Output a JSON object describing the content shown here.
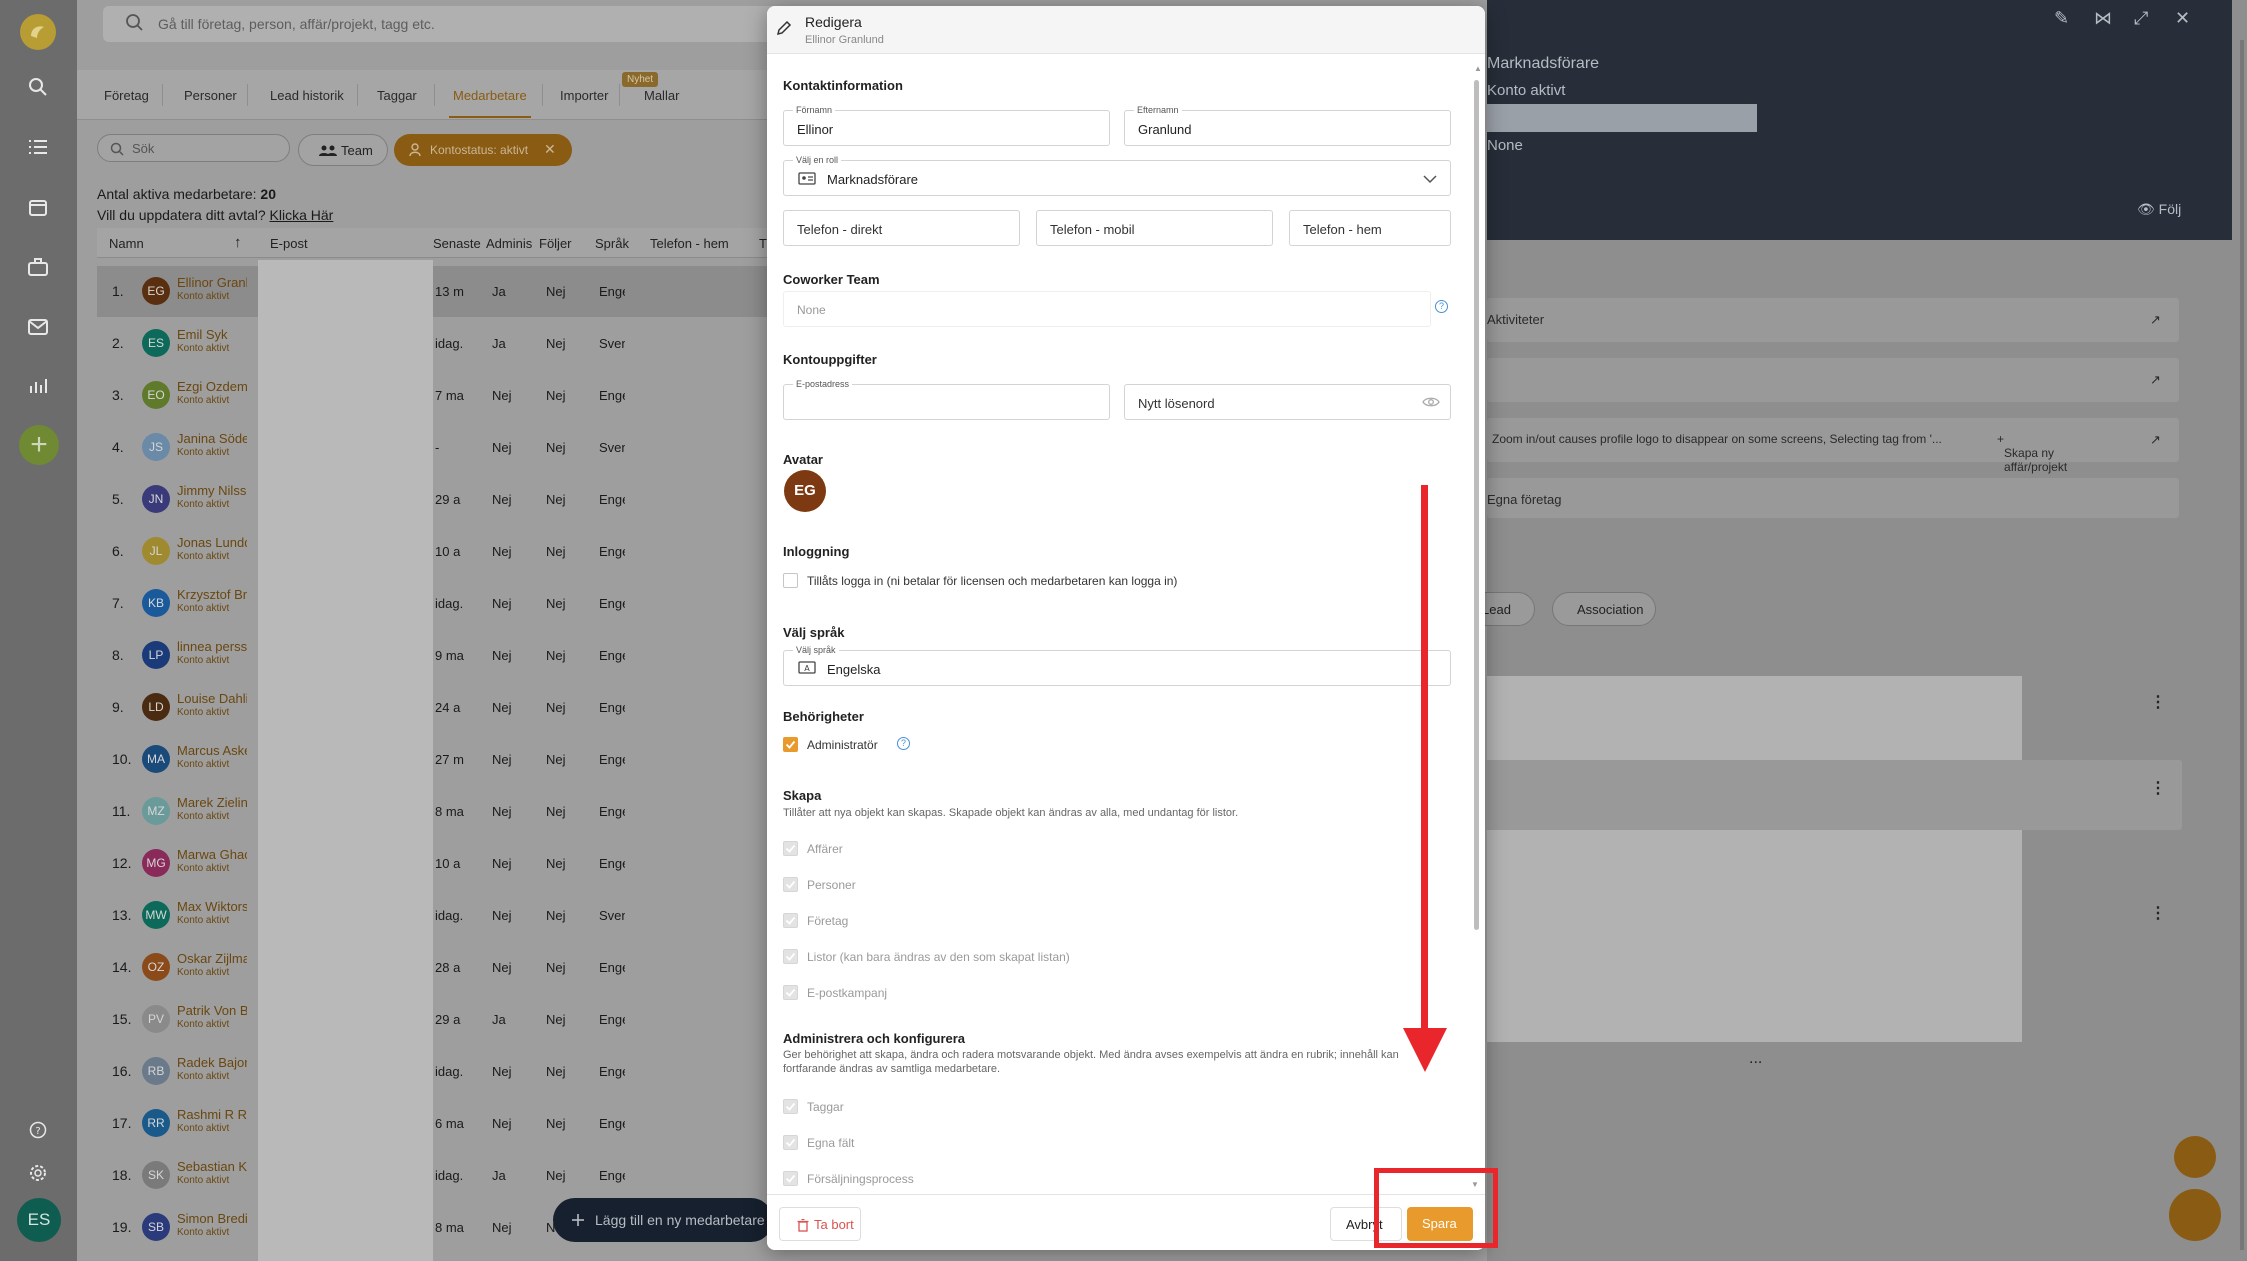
{
  "search": {
    "placeholder": "Gå till företag, person, affär/projekt, tagg etc."
  },
  "tabs": [
    {
      "label": "Företag"
    },
    {
      "label": "Personer"
    },
    {
      "label": "Lead historik"
    },
    {
      "label": "Taggar"
    },
    {
      "label": "Medarbetare"
    },
    {
      "label": "Importer"
    },
    {
      "label": "Mallar"
    }
  ],
  "nyhet_badge": "Nyhet",
  "filters": {
    "search_placeholder": "Sök",
    "team_label": "Team",
    "status_chip": "Kontostatus: aktivt"
  },
  "summary": {
    "count_label": "Antal aktiva medarbetare:",
    "count_value": "20",
    "update_text": "Vill du uppdatera ditt avtal?",
    "update_link": "Klicka Här"
  },
  "table": {
    "headers": [
      "Namn",
      "E-post",
      "Senaste",
      "Adminis",
      "Följer",
      "Språk",
      "Telefon - hem",
      "T"
    ],
    "status_label": "Konto aktivt",
    "rows": [
      {
        "num": "1.",
        "initials": "EG",
        "color": "#5a2f10",
        "name": "Ellinor Granlund",
        "senaste": "13 m",
        "admin": "Ja",
        "foljer": "Nej",
        "sprak": "Engelska"
      },
      {
        "num": "2.",
        "initials": "ES",
        "color": "#0d6a5a",
        "name": "Emil Syk",
        "senaste": "idag.",
        "admin": "Ja",
        "foljer": "Nej",
        "sprak": "Svenska"
      },
      {
        "num": "3.",
        "initials": "EO",
        "color": "#5f7a2a",
        "name": "Ezgi Ozdemir",
        "senaste": "7 ma",
        "admin": "Nej",
        "foljer": "Nej",
        "sprak": "Engelska"
      },
      {
        "num": "4.",
        "initials": "JS",
        "color": "#6a8aa8",
        "name": "Janina Söderberg",
        "senaste": "-",
        "admin": "Nej",
        "foljer": "Nej",
        "sprak": "Svenska"
      },
      {
        "num": "5.",
        "initials": "JN",
        "color": "#3a3a7a",
        "name": "Jimmy Nilsson",
        "senaste": "29 a",
        "admin": "Nej",
        "foljer": "Nej",
        "sprak": "Engelska"
      },
      {
        "num": "6.",
        "initials": "JL",
        "color": "#a08a30",
        "name": "Jonas Lundqvist",
        "senaste": "10 a",
        "admin": "Nej",
        "foljer": "Nej",
        "sprak": "Engelska"
      },
      {
        "num": "7.",
        "initials": "KB",
        "color": "#1a5a9a",
        "name": "Krzysztof Brzozowski",
        "senaste": "idag.",
        "admin": "Nej",
        "foljer": "Nej",
        "sprak": "Engelska"
      },
      {
        "num": "8.",
        "initials": "LP",
        "color": "#1a3a7a",
        "name": "linnea persson",
        "senaste": "9 ma",
        "admin": "Nej",
        "foljer": "Nej",
        "sprak": "Engelska"
      },
      {
        "num": "9.",
        "initials": "LD",
        "color": "#4a2a10",
        "name": "Louise Dahlin",
        "senaste": "24 a",
        "admin": "Nej",
        "foljer": "Nej",
        "sprak": "Engelska"
      },
      {
        "num": "10.",
        "initials": "MA",
        "color": "#1a4a7a",
        "name": "Marcus Askeröd",
        "senaste": "27 m",
        "admin": "Nej",
        "foljer": "Nej",
        "sprak": "Engelska"
      },
      {
        "num": "11.",
        "initials": "MZ",
        "color": "#6a9a9a",
        "name": "Marek Zielinski",
        "senaste": "8 ma",
        "admin": "Nej",
        "foljer": "Nej",
        "sprak": "Engelska"
      },
      {
        "num": "12.",
        "initials": "MG",
        "color": "#8a2a5a",
        "name": "Marwa Ghachem",
        "senaste": "10 a",
        "admin": "Nej",
        "foljer": "Nej",
        "sprak": "Engelska"
      },
      {
        "num": "13.",
        "initials": "MW",
        "color": "#0d6a5a",
        "name": "Max Wiktorsson",
        "senaste": "idag.",
        "admin": "Nej",
        "foljer": "Nej",
        "sprak": "Svenska"
      },
      {
        "num": "14.",
        "initials": "OZ",
        "color": "#8a4a1a",
        "name": "Oskar Zijlmans",
        "senaste": "28 a",
        "admin": "Nej",
        "foljer": "Nej",
        "sprak": "Engelska"
      },
      {
        "num": "15.",
        "initials": "PV",
        "color": "#8a8a8a",
        "name": "Patrik Von Bahr",
        "senaste": "29 a",
        "admin": "Ja",
        "foljer": "Nej",
        "sprak": "Engelska"
      },
      {
        "num": "16.",
        "initials": "RB",
        "color": "#6a7a8a",
        "name": "Radek Bajorek",
        "senaste": "idag.",
        "admin": "Nej",
        "foljer": "Nej",
        "sprak": "Engelska"
      },
      {
        "num": "17.",
        "initials": "RR",
        "color": "#1a5a8a",
        "name": "Rashmi R Rao",
        "senaste": "6 ma",
        "admin": "Nej",
        "foljer": "Nej",
        "sprak": "Engelska"
      },
      {
        "num": "18.",
        "initials": "SK",
        "color": "#7a7a7a",
        "name": "Sebastian Krause",
        "senaste": "idag.",
        "admin": "Ja",
        "foljer": "Nej",
        "sprak": "Engelska"
      },
      {
        "num": "19.",
        "initials": "SB",
        "color": "#2a3a7a",
        "name": "Simon Bredin",
        "senaste": "8 ma",
        "admin": "Nej",
        "foljer": "N",
        "sprak": ""
      }
    ]
  },
  "add_member_button": "Lägg till en ny medarbetare",
  "right_panel": {
    "role": "Marknadsförare",
    "status": "Konto aktivt",
    "team": "None",
    "follow": "Följ",
    "card1": "Aktiviteter",
    "card3_text": "Zoom in/out causes profile logo to disappear on some screens, Selecting tag from '...",
    "card3_action": "Skapa ny affär/projekt",
    "card4": "Egna företag",
    "pill1": "Lead",
    "pill2": "Association",
    "more": "..."
  },
  "modal": {
    "title": "Redigera",
    "subtitle": "Ellinor Granlund",
    "contact_title": "Kontaktinformation",
    "firstname_label": "Förnamn",
    "firstname": "Ellinor",
    "lastname_label": "Efternamn",
    "lastname": "Granlund",
    "role_label": "Välj en roll",
    "role_value": "Marknadsförare",
    "phone_direct": "Telefon - direkt",
    "phone_mobile": "Telefon - mobil",
    "phone_home": "Telefon - hem",
    "coworker_title": "Coworker Team",
    "coworker_value": "None",
    "account_title": "Kontouppgifter",
    "email_label": "E-postadress",
    "email_value": "",
    "password_placeholder": "Nytt lösenord",
    "avatar_title": "Avatar",
    "avatar_initials": "EG",
    "login_title": "Inloggning",
    "login_checkbox": "Tillåts logga in (ni betalar för licensen och medarbetaren kan logga in)",
    "language_title": "Välj språk",
    "language_label": "Välj språk",
    "language_value": "Engelska",
    "permissions_title": "Behörigheter",
    "admin_label": "Administratör",
    "create_title": "Skapa",
    "create_desc": "Tillåter att nya objekt kan skapas. Skapade objekt kan ändras av alla, med undantag för listor.",
    "create_items": [
      "Affärer",
      "Personer",
      "Företag",
      "Listor (kan bara ändras av den som skapat listan)",
      "E-postkampanj"
    ],
    "admin_config_title": "Administrera och konfigurera",
    "admin_config_desc": "Ger behörighet att skapa, ändra och radera motsvarande objekt. Med ändra avses exempelvis att ändra en rubrik; innehåll kan fortfarande ändras av samtliga medarbetare.",
    "admin_config_items": [
      "Taggar",
      "Egna fält",
      "Försäljningsprocess"
    ],
    "delete_button": "Ta bort",
    "cancel_button": "Avbryt",
    "save_button": "Spara"
  },
  "user_initials": "ES",
  "colors": {
    "accent": "#e99a2c",
    "annotation": "#e8262c",
    "dark_header": "#272e39"
  }
}
